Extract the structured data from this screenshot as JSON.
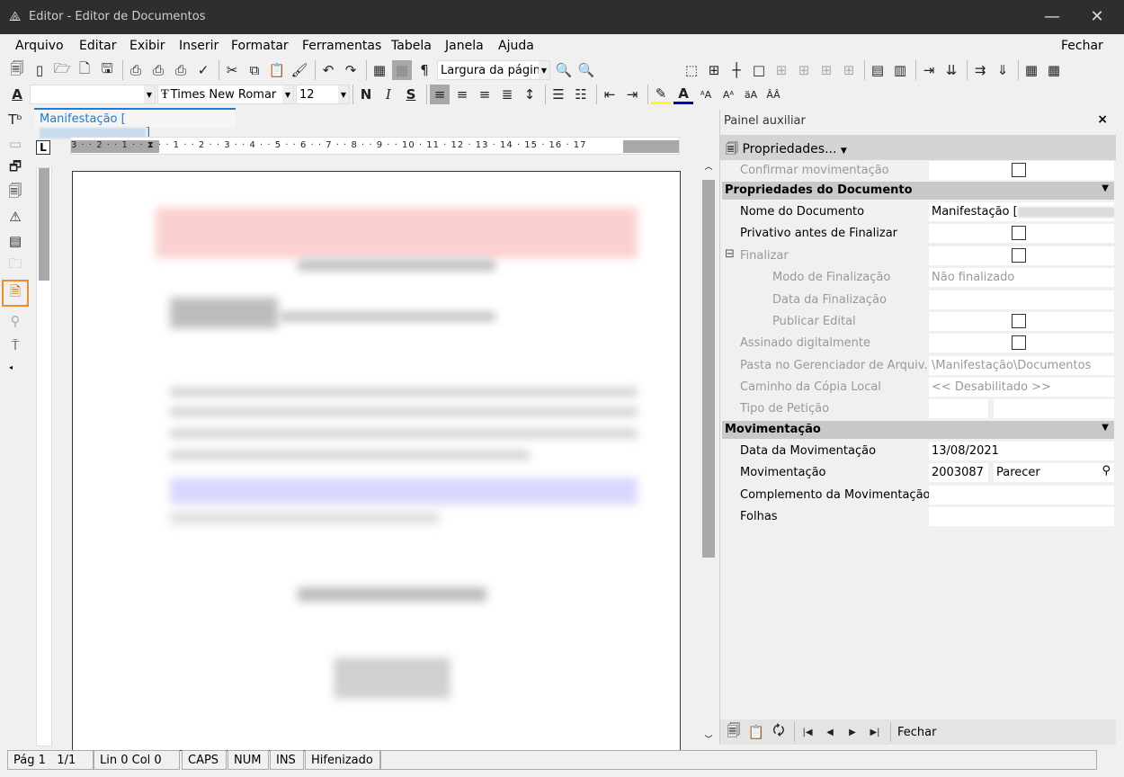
{
  "window": {
    "title": "Editor - Editor de Documentos",
    "minimize": "—",
    "close": "✕"
  },
  "menu": {
    "items": [
      "Arquivo",
      "Editar",
      "Exibir",
      "Inserir",
      "Formatar",
      "Ferramentas",
      "Tabela",
      "Janela",
      "Ajuda"
    ],
    "close": "Fechar"
  },
  "toolbar1": {
    "zoom_select": "Largura da págin"
  },
  "toolbar2": {
    "style_select": "",
    "font_select": "Times New Romar",
    "size_select": "12",
    "bold": "N",
    "italic": "I",
    "strike": "S"
  },
  "tab": {
    "label": "Manifestação [",
    "label_end": "]"
  },
  "ruler": {
    "numbers": "3 · · 2 · · 1 · · ⧗ · · 1 · · 2 · · 3 · · 4 · · 5 · · 6 · · 7 · · 8 · · 9 · · 10 · 11 · 12 · 13 · 14 · 15 · 16 · 17"
  },
  "panel": {
    "title": "Painel auxiliar",
    "close": "×",
    "properties_button": "Propriedades...",
    "top_rows": [
      {
        "label": "Confirmar movimentação",
        "type": "checkbox",
        "disabled": true
      }
    ],
    "sections": [
      {
        "title": "Propriedades do Documento",
        "rows": [
          {
            "label": "Nome do Documento",
            "value": "Manifestação ["
          },
          {
            "label": "Privativo antes de Finalizar",
            "type": "checkbox"
          },
          {
            "label": "Finalizar",
            "type": "checkbox",
            "disabled": true,
            "expander": "⊟"
          },
          {
            "label": "Modo de Finalização",
            "value": "Não finalizado",
            "disabled": true,
            "indent": true
          },
          {
            "label": "Data da Finalização",
            "value": "",
            "disabled": true,
            "indent": true
          },
          {
            "label": "Publicar Edital",
            "type": "checkbox",
            "disabled": true,
            "indent": true
          },
          {
            "label": "Assinado digitalmente",
            "type": "checkbox",
            "disabled": true
          },
          {
            "label": "Pasta no Gerenciador de Arquiv...",
            "value": "\\Manifestação\\Documentos",
            "disabled": true
          },
          {
            "label": "Caminho da Cópia Local",
            "value": "<< Desabilitado >>",
            "disabled": true
          },
          {
            "label": "Tipo de Petição",
            "value": "",
            "disabled": true
          }
        ]
      },
      {
        "title": "Movimentação",
        "rows": [
          {
            "label": "Data da Movimentação",
            "value": "13/08/2021"
          },
          {
            "label": "Movimentação",
            "value": "2003087",
            "value2": "Parecer"
          },
          {
            "label": "Complemento da Movimentação",
            "value": ""
          },
          {
            "label": "Folhas",
            "value": ""
          }
        ]
      }
    ],
    "footer_close": "Fechar"
  },
  "status": {
    "page": "Pág 1",
    "pages": "1/1",
    "pos": "Lin 0  Col 0",
    "caps": "CAPS",
    "num": "NUM",
    "ins": "INS",
    "hyph": "Hifenizado"
  },
  "colors": {
    "titlebar": "#2e2e2e",
    "accent": "#1e7bd6",
    "highlight": "#f28c28"
  }
}
